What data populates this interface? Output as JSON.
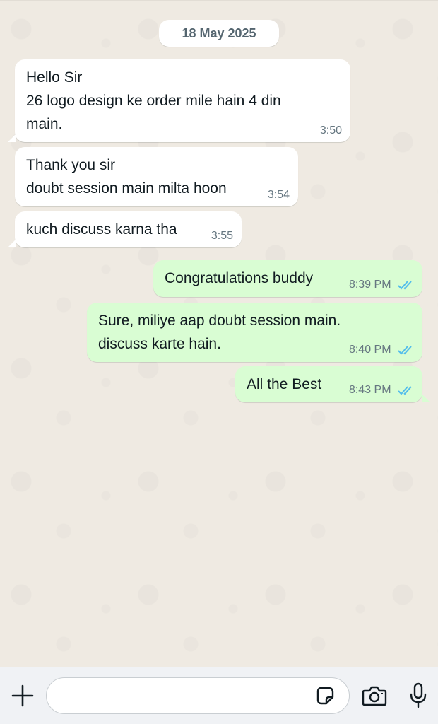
{
  "date_divider": "18 May 2025",
  "messages": [
    {
      "direction": "in",
      "text": "Hello Sir\n26 logo design ke order mile hain 4 din\nmain.",
      "time": "3:50"
    },
    {
      "direction": "in",
      "text": "Thank you sir\ndoubt session main milta hoon",
      "time": "3:54"
    },
    {
      "direction": "in",
      "text": "kuch discuss karna tha",
      "time": "3:55"
    },
    {
      "direction": "out",
      "text": "Congratulations buddy",
      "time": "8:39 PM",
      "status": "read"
    },
    {
      "direction": "out",
      "text": "Sure, miliye aap doubt session main.\ndiscuss karte hain.",
      "time": "8:40 PM",
      "status": "read"
    },
    {
      "direction": "out",
      "text": "All the Best",
      "time": "8:43 PM",
      "status": "read"
    }
  ],
  "composer": {
    "placeholder": "",
    "icons": [
      "plus-icon",
      "sticker-icon",
      "camera-icon",
      "microphone-icon"
    ]
  },
  "colors": {
    "chat_bg": "#efeae2",
    "incoming_bubble": "#ffffff",
    "outgoing_bubble": "#d9fdd3",
    "read_ticks": "#53bdeb",
    "timestamp": "#667781"
  }
}
